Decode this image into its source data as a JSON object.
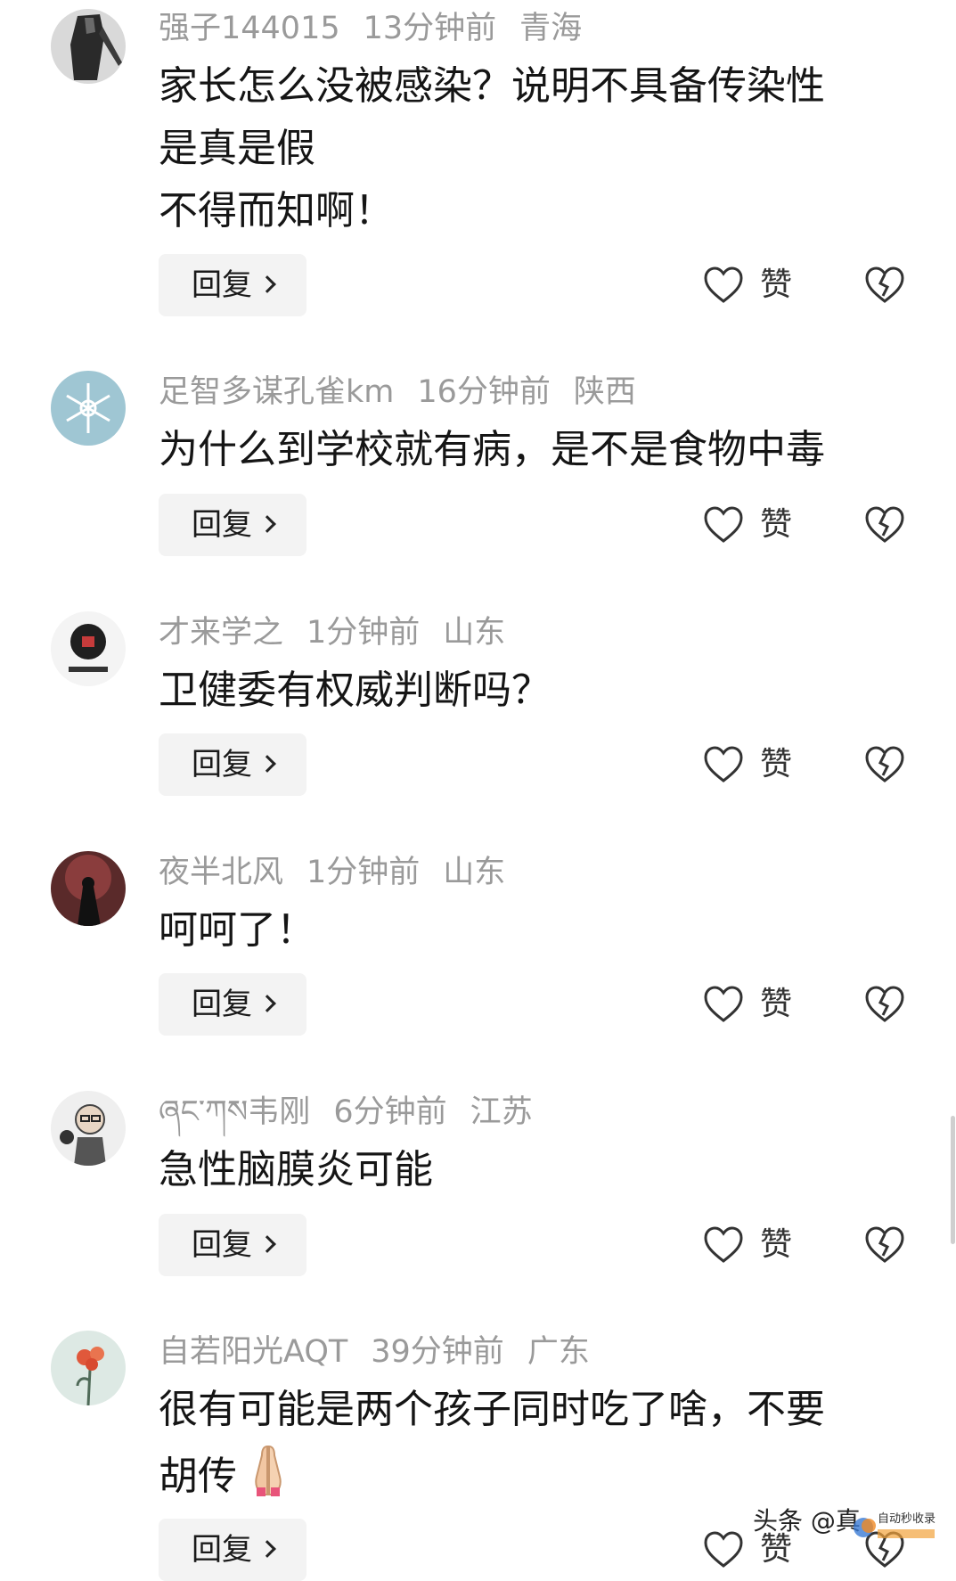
{
  "comments": [
    {
      "user": "强子144015",
      "time": "13分钟前",
      "location": "青海",
      "lines": [
        "家长怎么没被感染？说明不具备传染性",
        "是真是假",
        "不得而知啊！"
      ],
      "reply_label": "回复",
      "like_label": "赞"
    },
    {
      "user": "足智多谋孔雀km",
      "time": "16分钟前",
      "location": "陕西",
      "lines": [
        "为什么到学校就有病，是不是食物中毒"
      ],
      "reply_label": "回复",
      "like_label": "赞"
    },
    {
      "user": "才来学之",
      "time": "1分钟前",
      "location": "山东",
      "lines": [
        "卫健委有权威判断吗？"
      ],
      "reply_label": "回复",
      "like_label": "赞"
    },
    {
      "user": "夜半北风",
      "time": "1分钟前",
      "location": "山东",
      "lines": [
        "呵呵了！"
      ],
      "reply_label": "回复",
      "like_label": "赞"
    },
    {
      "user": "ཞང་ཀས韦刚",
      "time": "6分钟前",
      "location": "江苏",
      "lines": [
        "急性脑膜炎可能"
      ],
      "reply_label": "回复",
      "like_label": "赞"
    },
    {
      "user": "自若阳光AQT",
      "time": "39分钟前",
      "location": "广东",
      "lines": [
        "很有可能是两个孩子同时吃了啥，不要",
        "胡传"
      ],
      "reply_label": "回复",
      "like_label": "赞"
    }
  ],
  "watermark": {
    "text": "头条 @真",
    "logo_text": "自动秒收录"
  },
  "colors": {
    "meta": "#9a9a9a",
    "text": "#151515",
    "reply_bg": "#f3f3f3"
  },
  "icons": {
    "like": "heart-outline-icon",
    "dislike": "broken-heart-icon",
    "reply_arrow": "chevron-right-icon",
    "emoji": "folded-hands-emoji"
  }
}
